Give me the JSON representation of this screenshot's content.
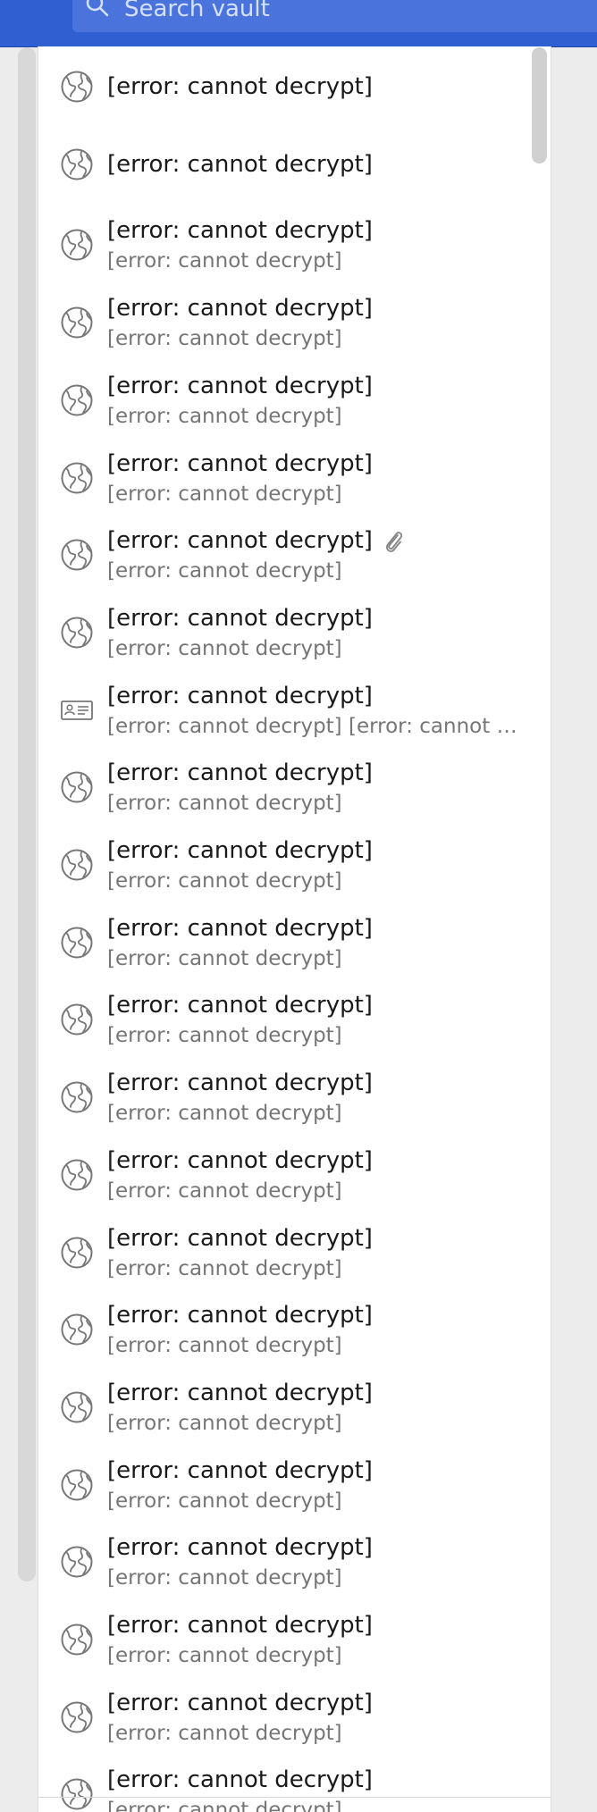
{
  "search": {
    "placeholder": "Search vault"
  },
  "items": [
    {
      "name": "[error: cannot decrypt]",
      "subtitle": "",
      "icon": "globe-icon",
      "attachment": false
    },
    {
      "name": "[error: cannot decrypt]",
      "subtitle": "",
      "icon": "globe-icon",
      "attachment": false
    },
    {
      "name": "[error: cannot decrypt]",
      "subtitle": "[error: cannot decrypt]",
      "icon": "globe-icon",
      "attachment": false
    },
    {
      "name": "[error: cannot decrypt]",
      "subtitle": "[error: cannot decrypt]",
      "icon": "globe-icon",
      "attachment": false
    },
    {
      "name": "[error: cannot decrypt]",
      "subtitle": "[error: cannot decrypt]",
      "icon": "globe-icon",
      "attachment": false
    },
    {
      "name": "[error: cannot decrypt]",
      "subtitle": "[error: cannot decrypt]",
      "icon": "globe-icon",
      "attachment": false
    },
    {
      "name": "[error: cannot decrypt]",
      "subtitle": "[error: cannot decrypt]",
      "icon": "globe-icon",
      "attachment": true
    },
    {
      "name": "[error: cannot decrypt]",
      "subtitle": "[error: cannot decrypt]",
      "icon": "globe-icon",
      "attachment": false
    },
    {
      "name": "[error: cannot decrypt]",
      "subtitle": "[error: cannot decrypt] [error: cannot d…",
      "icon": "id-card-icon",
      "attachment": false
    },
    {
      "name": "[error: cannot decrypt]",
      "subtitle": "[error: cannot decrypt]",
      "icon": "globe-icon",
      "attachment": false
    },
    {
      "name": "[error: cannot decrypt]",
      "subtitle": "[error: cannot decrypt]",
      "icon": "globe-icon",
      "attachment": false
    },
    {
      "name": "[error: cannot decrypt]",
      "subtitle": "[error: cannot decrypt]",
      "icon": "globe-icon",
      "attachment": false
    },
    {
      "name": "[error: cannot decrypt]",
      "subtitle": "[error: cannot decrypt]",
      "icon": "globe-icon",
      "attachment": false
    },
    {
      "name": "[error: cannot decrypt]",
      "subtitle": "[error: cannot decrypt]",
      "icon": "globe-icon",
      "attachment": false
    },
    {
      "name": "[error: cannot decrypt]",
      "subtitle": "[error: cannot decrypt]",
      "icon": "globe-icon",
      "attachment": false
    },
    {
      "name": "[error: cannot decrypt]",
      "subtitle": "[error: cannot decrypt]",
      "icon": "globe-icon",
      "attachment": false
    },
    {
      "name": "[error: cannot decrypt]",
      "subtitle": "[error: cannot decrypt]",
      "icon": "globe-icon",
      "attachment": false
    },
    {
      "name": "[error: cannot decrypt]",
      "subtitle": "[error: cannot decrypt]",
      "icon": "globe-icon",
      "attachment": false
    },
    {
      "name": "[error: cannot decrypt]",
      "subtitle": "[error: cannot decrypt]",
      "icon": "globe-icon",
      "attachment": false
    },
    {
      "name": "[error: cannot decrypt]",
      "subtitle": "[error: cannot decrypt]",
      "icon": "globe-icon",
      "attachment": false
    },
    {
      "name": "[error: cannot decrypt]",
      "subtitle": "[error: cannot decrypt]",
      "icon": "globe-icon",
      "attachment": false
    },
    {
      "name": "[error: cannot decrypt]",
      "subtitle": "[error: cannot decrypt]",
      "icon": "globe-icon",
      "attachment": false
    },
    {
      "name": "[error: cannot decrypt]",
      "subtitle": "[error: cannot decrypt]",
      "icon": "globe-icon",
      "attachment": false
    }
  ],
  "colors": {
    "header": "#2f5fd0",
    "search_box": "#4a74dc",
    "item_text": "#1a1a1a",
    "item_subtext": "#767676",
    "icon_stroke": "#777777"
  }
}
